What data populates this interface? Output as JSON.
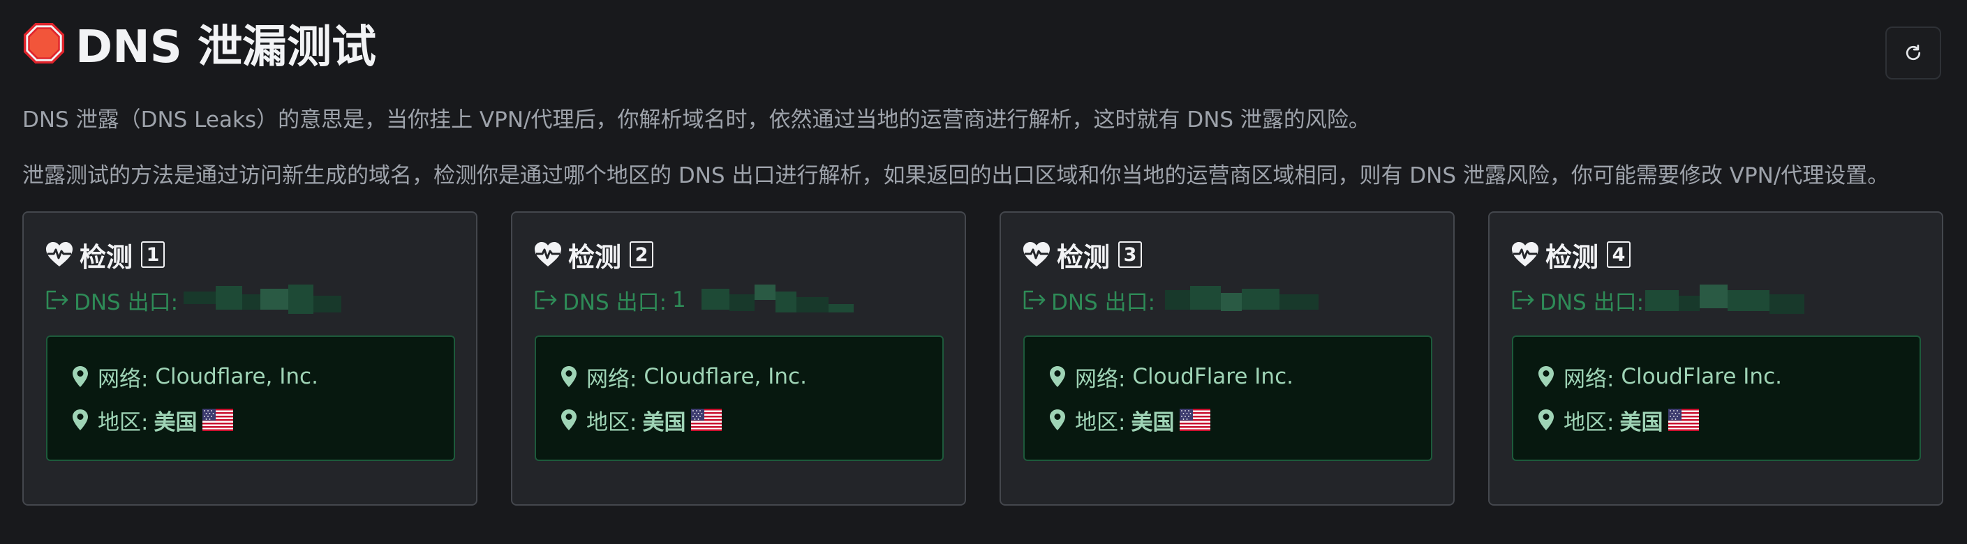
{
  "header": {
    "icon": "stop-sign-icon",
    "title": "DNS 泄漏测试"
  },
  "toolbar": {
    "refresh_icon": "refresh-icon"
  },
  "description": {
    "line1": "DNS 泄露（DNS Leaks）的意思是，当你挂上 VPN/代理后，你解析域名时，依然通过当地的运营商进行解析，这时就有 DNS 泄露的风险。",
    "line2": "泄露测试的方法是通过访问新生成的域名，检测你是通过哪个地区的 DNS 出口进行解析，如果返回的出口区域和你当地的运营商区域相同，则有 DNS 泄露风险，你可能需要修改 VPN/代理设置。"
  },
  "cards": [
    {
      "title": "检测",
      "index": "1",
      "dns_label": "DNS 出口:",
      "dns_visible_prefix": "",
      "network_label": "网络:",
      "network_value": "Cloudflare, Inc.",
      "region_label": "地区:",
      "region_value": "美国",
      "flag": "us-flag-icon"
    },
    {
      "title": "检测",
      "index": "2",
      "dns_label": "DNS 出口:",
      "dns_visible_prefix": "1",
      "network_label": "网络:",
      "network_value": "Cloudflare, Inc.",
      "region_label": "地区:",
      "region_value": "美国",
      "flag": "us-flag-icon"
    },
    {
      "title": "检测",
      "index": "3",
      "dns_label": "DNS 出口:",
      "dns_visible_prefix": "",
      "network_label": "网络:",
      "network_value": "CloudFlare Inc.",
      "region_label": "地区:",
      "region_value": "美国",
      "flag": "us-flag-icon"
    },
    {
      "title": "检测",
      "index": "4",
      "dns_label": "DNS 出口:",
      "dns_visible_prefix": "",
      "network_label": "网络:",
      "network_value": "CloudFlare Inc.",
      "region_label": "地区:",
      "region_value": "美国",
      "flag": "us-flag-icon"
    }
  ],
  "colors": {
    "background": "#18191c",
    "card_bg": "#232529",
    "card_border": "#44474d",
    "accent_green": "#2e8b57",
    "info_bg": "#07180f",
    "info_border": "#1d5a3b",
    "info_text": "#9fd4b6",
    "description_text": "#9ea3ab"
  }
}
